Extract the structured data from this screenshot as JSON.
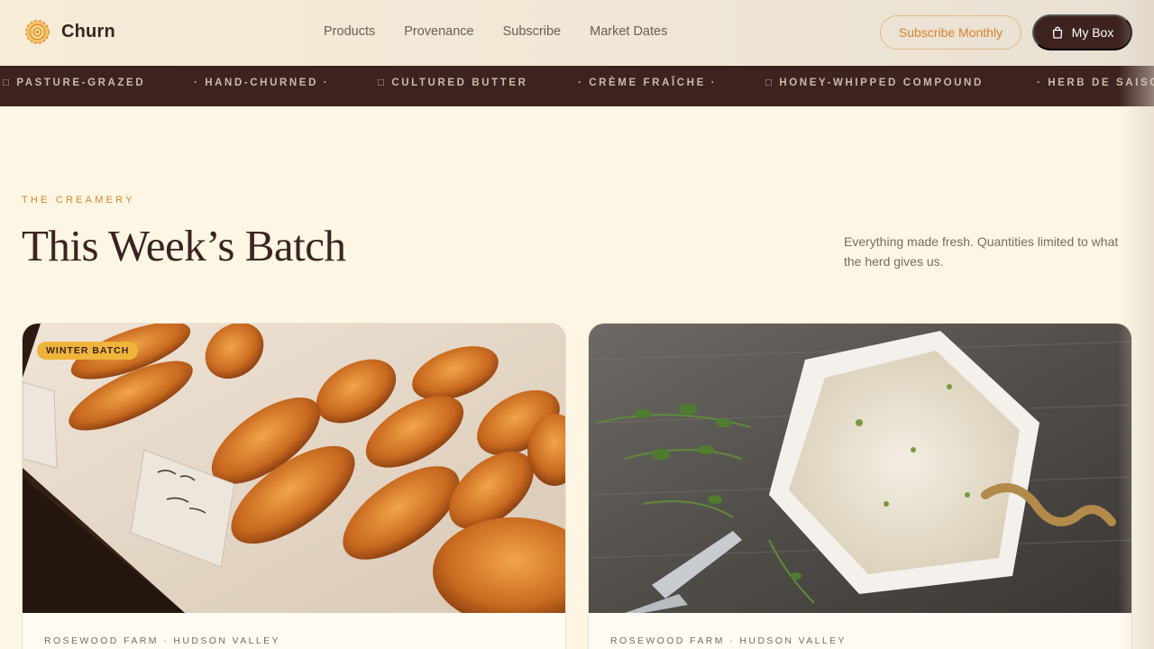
{
  "brand": {
    "name": "Churn",
    "icon": "sun-churn-logo-icon"
  },
  "nav": {
    "items": [
      {
        "label": "Products"
      },
      {
        "label": "Provenance"
      },
      {
        "label": "Subscribe"
      },
      {
        "label": "Market Dates"
      }
    ]
  },
  "header": {
    "subscribe_label": "Subscribe Monthly",
    "box_label": "My Box",
    "box_icon": "shopping-bag-icon"
  },
  "ticker": {
    "items": [
      "□ PASTURE-GRAZED",
      "· HAND-CHURNED ·",
      "□ CULTURED BUTTER",
      "· CRÈME FRAÎCHE ·",
      "□ HONEY-WHIPPED COMPOUND",
      "· HERB DE SAISON"
    ]
  },
  "section": {
    "eyebrow": "THE CREAMERY",
    "title": "This Week’s Batch",
    "intro": "Everything made fresh. Quantities limited to what the herd gives us."
  },
  "cards": [
    {
      "badge": "WINTER BATCH",
      "meta": "ROSEWOOD FARM · HUDSON VALLEY",
      "image": "croissant-pastry-photo"
    },
    {
      "badge": "",
      "meta": "ROSEWOOD FARM · HUDSON VALLEY",
      "image": "herb-butter-dish-photo"
    }
  ],
  "colors": {
    "accent": "#d8832c",
    "dark": "#3d2220",
    "background": "#fdf6e4",
    "badge": "#f0b43b"
  }
}
